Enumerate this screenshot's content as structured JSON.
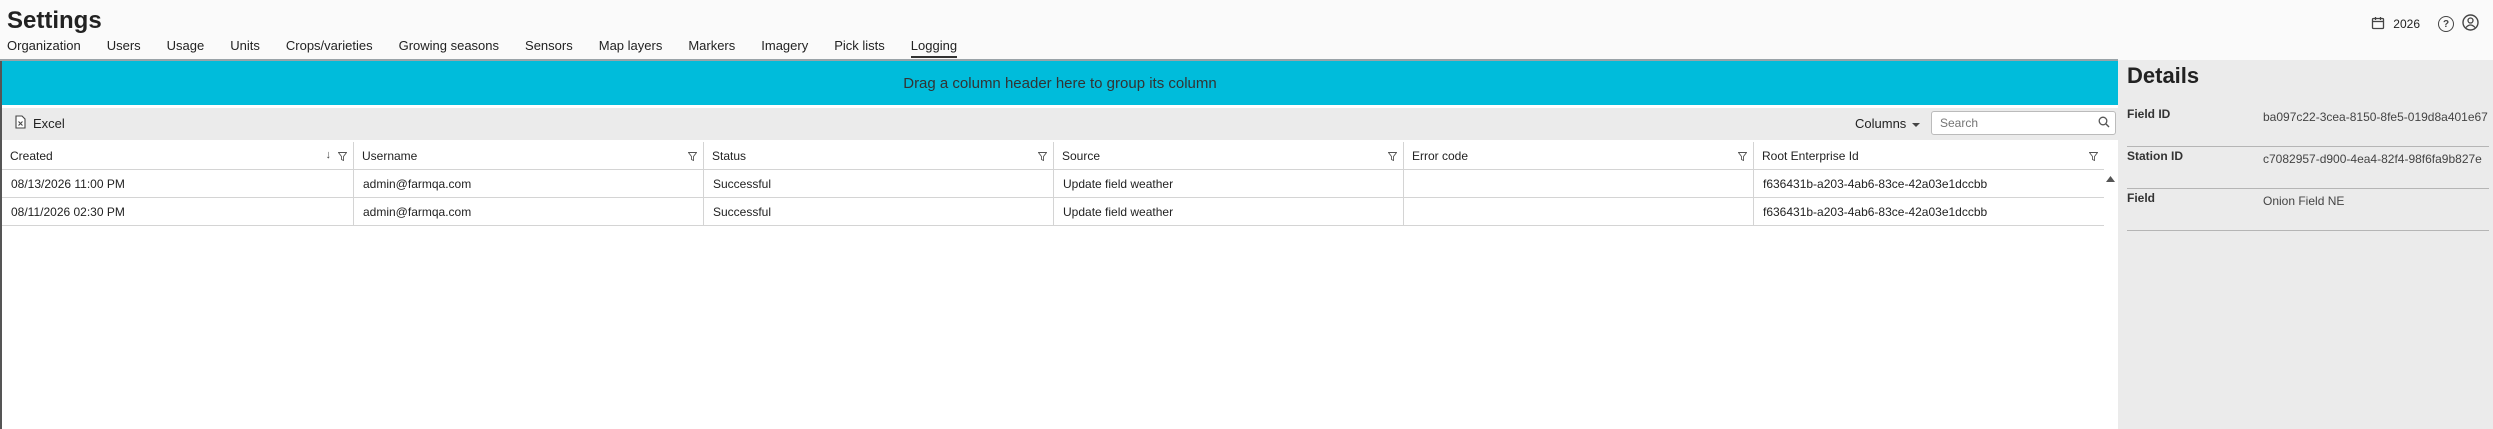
{
  "header": {
    "title": "Settings",
    "year": "2026",
    "tabs": [
      {
        "label": "Organization"
      },
      {
        "label": "Users"
      },
      {
        "label": "Usage"
      },
      {
        "label": "Units"
      },
      {
        "label": "Crops/varieties"
      },
      {
        "label": "Growing seasons"
      },
      {
        "label": "Sensors"
      },
      {
        "label": "Map layers"
      },
      {
        "label": "Markers"
      },
      {
        "label": "Imagery"
      },
      {
        "label": "Pick lists"
      },
      {
        "label": "Logging",
        "active": true
      }
    ]
  },
  "grid": {
    "group_banner": "Drag a column header here to group its column",
    "excel_label": "Excel",
    "columns_label": "Columns",
    "search_placeholder": "Search",
    "headers": [
      "Created",
      "Username",
      "Status",
      "Source",
      "Error code",
      "Root Enterprise Id"
    ],
    "rows": [
      [
        "08/13/2026 11:00 PM",
        "admin@farmqa.com",
        "Successful",
        "Update field weather",
        "",
        "f636431b-a203-4ab6-83ce-42a03e1dccbb"
      ],
      [
        "08/11/2026 02:30 PM",
        "admin@farmqa.com",
        "Successful",
        "Update field weather",
        "",
        "f636431b-a203-4ab6-83ce-42a03e1dccbb"
      ]
    ]
  },
  "details": {
    "title": "Details",
    "items": [
      {
        "label": "Field ID",
        "value": "ba097c22-3cea-8150-8fe5-019d8a401e67"
      },
      {
        "label": "Station ID",
        "value": "c7082957-d900-4ea4-82f4-98f6fa9b827e"
      },
      {
        "label": "Field",
        "value": "Onion Field NE"
      }
    ]
  },
  "colors": {
    "banner": "#00bcdb",
    "panel": "#ebebeb"
  }
}
